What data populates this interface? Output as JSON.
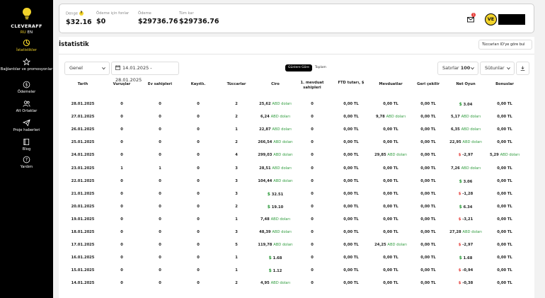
{
  "brand": {
    "name": "CLEVERAFF",
    "lang_ru": "RU",
    "lang_en": "EN"
  },
  "nav": [
    {
      "label": "İstatistikler",
      "icon": "chart-icon",
      "active": true
    },
    {
      "label": "Bağlantılar ve promosyonlar",
      "icon": "star-icon",
      "active": false
    },
    {
      "label": "Ödemeler",
      "icon": "dollar-icon",
      "active": false
    },
    {
      "label": "Alt Ortaklar",
      "icon": "users-icon",
      "active": false
    },
    {
      "label": "Proje haberleri",
      "icon": "send-icon",
      "active": false
    },
    {
      "label": "Blog",
      "icon": "book-icon",
      "active": false
    },
    {
      "label": "Yardım",
      "icon": "help-icon",
      "active": false
    }
  ],
  "header": {
    "stats": [
      {
        "label": "Denge",
        "value": "$32.16"
      },
      {
        "label": "Ödeme için fonlar",
        "value": "$0"
      },
      {
        "label": "Ödeme",
        "value": "$29736.76"
      },
      {
        "label": "Tüm kar",
        "value": "$29736.76"
      }
    ],
    "notif_count": "1",
    "avatar": "VE"
  },
  "page": {
    "title": "İstatistik",
    "search_label": "Tüccarları ID'ye göre bul"
  },
  "filters": {
    "group": "Genel",
    "date_range": "14.01.2025 - 28.01.2025",
    "seg_on": "Günlere Göre",
    "seg_off": "Toplam",
    "rows_label": "Satırlar",
    "rows_value": "100",
    "columns_label": "Sütunlar"
  },
  "table": {
    "headers": [
      "Tarih",
      "Vuruşlar",
      "Ev sahipleri",
      "Kayıtlı.",
      "Tüccarlar",
      "Ciro",
      "1. mevduat sahipleri",
      "FTD tutarı, $",
      "Mevduatlar",
      "Geri çekilir",
      "Net Oyun",
      "Bonuslar"
    ],
    "rows": [
      [
        "28.01.2025",
        "0",
        "0",
        "0",
        "2",
        "25,62 ABD doları",
        "0",
        "0,00 TL",
        "0,00 TL",
        "0,00 TL",
        "$ 3.04",
        "0,00 TL"
      ],
      [
        "27.01.2025",
        "0",
        "0",
        "0",
        "2",
        "6,24 ABD doları",
        "0",
        "0,00 TL",
        "9,78 ABD doları",
        "0,00 TL",
        "5,17 ABD doları",
        "0,00 TL"
      ],
      [
        "26.01.2025",
        "0",
        "0",
        "0",
        "1",
        "22,87 ABD doları",
        "0",
        "0,00 TL",
        "0,00 TL",
        "0,00 TL",
        "6,35 ABD doları",
        "0,00 TL"
      ],
      [
        "25.01.2025",
        "0",
        "0",
        "0",
        "2",
        "266,54 ABD doları",
        "0",
        "0,00 TL",
        "0,00 TL",
        "0,00 TL",
        "22,95 ABD doları",
        "0,00 TL"
      ],
      [
        "24.01.2025",
        "0",
        "0",
        "0",
        "4",
        "299,03 ABD doları",
        "0",
        "0,00 TL",
        "29,85 ABD doları",
        "0,00 TL",
        "$ -2,97",
        "5,29 ABD doları"
      ],
      [
        "23.01.2025",
        "1",
        "1",
        "0",
        "3",
        "28,51 ABD doları",
        "0",
        "0,00 TL",
        "0,00 TL",
        "0,00 TL",
        "7,26 ABD doları",
        "0,00 TL"
      ],
      [
        "22.01.2025",
        "0",
        "0",
        "0",
        "3",
        "104,44 ABD doları",
        "0",
        "0,00 TL",
        "0,00 TL",
        "0,00 TL",
        "$ 3.06",
        "0,00 TL"
      ],
      [
        "21.01.2025",
        "0",
        "0",
        "0",
        "3",
        "$ 32.51",
        "0",
        "0,00 TL",
        "0,00 TL",
        "0,00 TL",
        "$ -1,28",
        "0,00 TL"
      ],
      [
        "20.01.2025",
        "0",
        "0",
        "0",
        "2",
        "$ 19.10",
        "0",
        "0,00 TL",
        "0,00 TL",
        "0,00 TL",
        "$ 6.34",
        "0,00 TL"
      ],
      [
        "19.01.2025",
        "0",
        "0",
        "0",
        "1",
        "7,48 ABD doları",
        "0",
        "0,00 TL",
        "0,00 TL",
        "0,00 TL",
        "$ -3,21",
        "0,00 TL"
      ],
      [
        "18.01.2025",
        "0",
        "0",
        "0",
        "3",
        "48,39 ABD doları",
        "0",
        "0,00 TL",
        "0,00 TL",
        "0,00 TL",
        "27,28 ABD doları",
        "0,00 TL"
      ],
      [
        "17.01.2025",
        "0",
        "0",
        "0",
        "5",
        "119,78 ABD doları",
        "0",
        "0,00 TL",
        "24,25 ABD doları",
        "0,00 TL",
        "$ -2,97",
        "0,00 TL"
      ],
      [
        "16.01.2025",
        "0",
        "0",
        "0",
        "1",
        "$ 1.68",
        "0",
        "0,00 TL",
        "0,00 TL",
        "0,00 TL",
        "$ 1.68",
        "0,00 TL"
      ],
      [
        "15.01.2025",
        "0",
        "0",
        "0",
        "1",
        "$ 1.12",
        "0",
        "0,00 TL",
        "0,00 TL",
        "0,00 TL",
        "$ -0,94",
        "0,00 TL"
      ],
      [
        "14.01.2025",
        "0",
        "0",
        "0",
        "2",
        "4,95 ABD doları",
        "0",
        "0,00 TL",
        "0,00 TL",
        "0,00 TL",
        "$ -0,38",
        "0,00 TL"
      ]
    ]
  }
}
